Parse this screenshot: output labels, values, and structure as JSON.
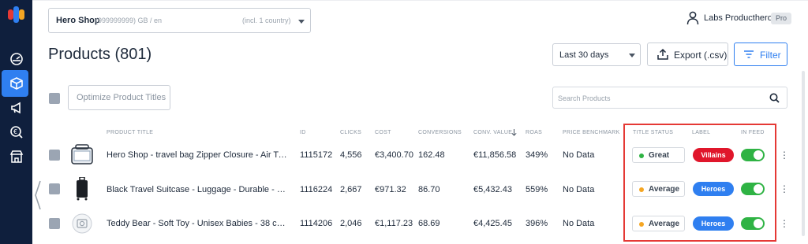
{
  "sidebar": {
    "items": [
      {
        "icon": "dashboard-icon"
      },
      {
        "icon": "box-icon",
        "active": true
      },
      {
        "icon": "megaphone-icon"
      },
      {
        "icon": "euro-search-icon"
      },
      {
        "icon": "store-icon"
      }
    ]
  },
  "header": {
    "shop_name": "Hero Shop",
    "shop_meta": "(999999999) GB / en",
    "shop_count": "(incl. 1 country)",
    "user_name": "Labs Producthero",
    "plan_badge": "Pro"
  },
  "page": {
    "title": "Products (801)",
    "date_range": "Last 30 days",
    "export_label": "Export (.csv)",
    "filter_label": "Filter",
    "optimize_label": "Optimize Product Titles",
    "search_placeholder": "Search Products"
  },
  "table": {
    "columns": {
      "title": "PRODUCT TITLE",
      "id": "ID",
      "clicks": "CLICKS",
      "cost": "COST",
      "conversions": "CONVERSIONS",
      "conv_value": "CONV. VALUE",
      "roas": "ROAS",
      "price_benchmark": "PRICE BENCHMARK",
      "title_status": "TITLE STATUS",
      "label": "LABEL",
      "in_feed": "IN FEED"
    },
    "rows": [
      {
        "title": "Hero Shop - travel bag Zipper Closure - Air Travel ...",
        "id": "1115172",
        "clicks": "4,556",
        "cost": "€3,400.70",
        "conversions": "162.48",
        "conv_value": "€11,856.58",
        "roas": "349%",
        "price_benchmark": "No Data",
        "title_status": "Great",
        "status_color": "#2fb344",
        "label": "Villains",
        "label_color": "#e0162b",
        "in_feed": true
      },
      {
        "title": "Black Travel Suitcase - Luggage - Durable - Lightw...",
        "id": "1116224",
        "clicks": "2,667",
        "cost": "€971.32",
        "conversions": "86.70",
        "conv_value": "€5,432.43",
        "roas": "559%",
        "price_benchmark": "No Data",
        "title_status": "Average",
        "status_color": "#f5a623",
        "label": "Heroes",
        "label_color": "#2f7ff0",
        "in_feed": true
      },
      {
        "title": "Teddy Bear - Soft Toy - Unisex Babies - 38 cm - Her...",
        "id": "1114206",
        "clicks": "2,046",
        "cost": "€1,117.23",
        "conversions": "68.69",
        "conv_value": "€4,425.45",
        "roas": "396%",
        "price_benchmark": "No Data",
        "title_status": "Average",
        "status_color": "#f5a623",
        "label": "Heroes",
        "label_color": "#2f7ff0",
        "in_feed": true
      }
    ]
  }
}
